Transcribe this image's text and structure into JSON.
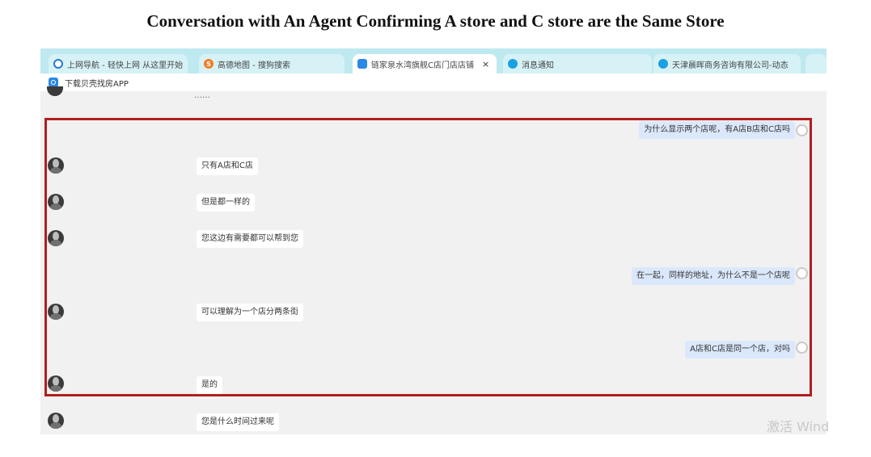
{
  "caption": "Conversation with An Agent Confirming A store and C store are the Same Store",
  "tabs": [
    {
      "label": "上网导航 - 轻快上网 从这里开始",
      "icon": "edge-icon",
      "active": false
    },
    {
      "label": "高德地图 - 搜狗搜索",
      "icon": "sogou-icon",
      "active": false
    },
    {
      "label": "链家泉水湾旗舰C店门店店铺",
      "icon": "app-icon",
      "active": true,
      "close": "×"
    },
    {
      "label": "消息通知",
      "icon": "message-icon",
      "active": false
    },
    {
      "label": "天津晨晖商务咨询有限公司-动态",
      "icon": "message-icon",
      "active": false
    }
  ],
  "bookmark": {
    "label": "下载贝壳找房APP",
    "icon": "app-icon"
  },
  "partial_text": "……",
  "messages": [
    {
      "side": "right",
      "text": "为什么显示两个店呢，有A店B店和C店吗"
    },
    {
      "side": "left",
      "text": "只有A店和C店"
    },
    {
      "side": "left",
      "text": "但是都一样的"
    },
    {
      "side": "left",
      "text": "您这边有需要都可以帮到您"
    },
    {
      "side": "right",
      "text": "在一起，同样的地址，为什么不是一个店呢"
    },
    {
      "side": "left",
      "text": "可以理解为一个店分两条街"
    },
    {
      "side": "right",
      "text": "A店和C店是同一个店，对吗"
    },
    {
      "side": "left",
      "text": "是的"
    },
    {
      "side": "left",
      "text": "您是什么时间过来呢"
    }
  ],
  "watermark": "激活 Wind",
  "colors": {
    "highlight_border": "#b01e1e",
    "tabbar": "#bfe9f0",
    "user_bubble": "#dbe8fb"
  }
}
